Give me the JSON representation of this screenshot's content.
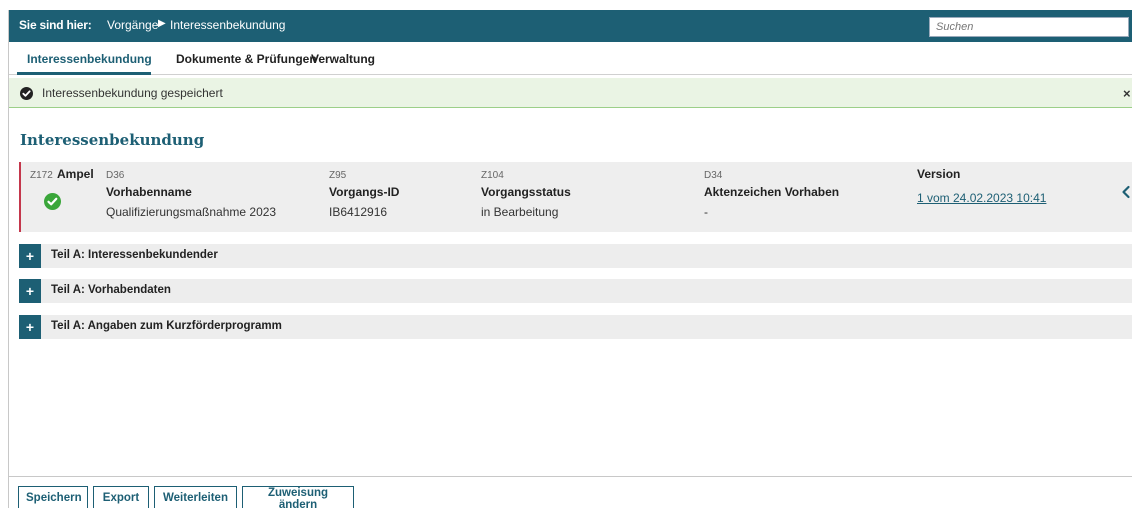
{
  "breadcrumb": {
    "label": "Sie sind hier:",
    "parent": "Vorgänge",
    "separator": "▶",
    "current": "Interessenbekundung"
  },
  "search": {
    "placeholder": "Suchen"
  },
  "tabs": [
    {
      "label": "Interessenbekundung",
      "active": true
    },
    {
      "label": "Dokumente & Prüfungen",
      "active": false
    },
    {
      "label": "Verwaltung",
      "active": false
    }
  ],
  "notification": {
    "text": "Interessenbekundung gespeichert",
    "close_label": "×"
  },
  "page_title": "Interessenbekundung",
  "summary": {
    "ampel": {
      "code": "Z172",
      "label": "Ampel",
      "status_color": "#3aa63a"
    },
    "fields": [
      {
        "code": "D36",
        "label": "Vorhabenname",
        "value": "Qualifizierungsmaßnahme 2023"
      },
      {
        "code": "Z95",
        "label": "Vorgangs-ID",
        "value": "IB6412916"
      },
      {
        "code": "Z104",
        "label": "Vorgangsstatus",
        "value": "in Bearbeitung"
      },
      {
        "code": "D34",
        "label": "Aktenzeichen Vorhaben",
        "value": "-"
      }
    ],
    "version": {
      "label": "Version",
      "value": "1 vom 24.02.2023 10:41"
    },
    "collapse_icon": "chevron-left-icon"
  },
  "sections": [
    {
      "label": "Teil A: Interessenbekundender",
      "toggle": "+"
    },
    {
      "label": "Teil A: Vorhabendaten",
      "toggle": "+"
    },
    {
      "label": "Teil A: Angaben zum Kurzförderprogramm",
      "toggle": "+"
    }
  ],
  "toolbar": {
    "buttons": [
      "Speichern",
      "Export",
      "Weiterleiten",
      "Zuweisung ändern"
    ]
  },
  "colors": {
    "primary": "#1d5f74",
    "success_bg": "#eaf4e4",
    "status_green": "#3aa63a",
    "accent_red": "#c4374c"
  }
}
